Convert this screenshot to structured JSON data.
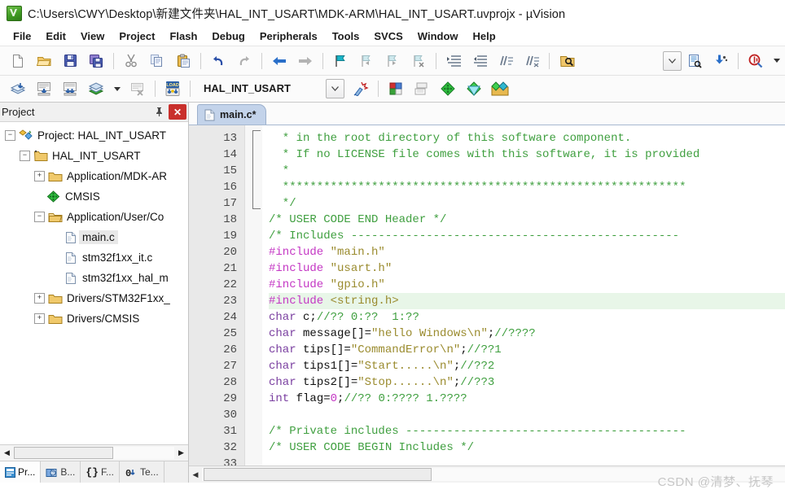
{
  "window": {
    "title": "C:\\Users\\CWY\\Desktop\\新建文件夹\\HAL_INT_USART\\MDK-ARM\\HAL_INT_USART.uvprojx - µVision",
    "app_icon": "uvision-icon"
  },
  "menubar": {
    "items": [
      {
        "label": "File"
      },
      {
        "label": "Edit"
      },
      {
        "label": "View"
      },
      {
        "label": "Project"
      },
      {
        "label": "Flash"
      },
      {
        "label": "Debug"
      },
      {
        "label": "Peripherals"
      },
      {
        "label": "Tools"
      },
      {
        "label": "SVCS"
      },
      {
        "label": "Window"
      },
      {
        "label": "Help"
      }
    ]
  },
  "toolbar_main": {
    "buttons": [
      {
        "name": "new-file-icon",
        "title": "New"
      },
      {
        "name": "open-file-icon",
        "title": "Open"
      },
      {
        "name": "save-icon",
        "title": "Save"
      },
      {
        "name": "save-all-icon",
        "title": "Save All"
      },
      {
        "name": "cut-icon",
        "title": "Cut"
      },
      {
        "name": "copy-icon",
        "title": "Copy"
      },
      {
        "name": "paste-icon",
        "title": "Paste"
      },
      {
        "name": "undo-icon",
        "title": "Undo"
      },
      {
        "name": "redo-icon",
        "title": "Redo"
      },
      {
        "name": "navigate-back-icon",
        "title": "Back"
      },
      {
        "name": "navigate-forward-icon",
        "title": "Forward"
      },
      {
        "name": "bookmark-toggle-icon",
        "title": "Insert/Remove Bookmark"
      },
      {
        "name": "bookmark-prev-icon",
        "title": "Previous Bookmark"
      },
      {
        "name": "bookmark-next-icon",
        "title": "Next Bookmark"
      },
      {
        "name": "bookmark-clear-icon",
        "title": "Clear All Bookmarks"
      },
      {
        "name": "indent-right-icon",
        "title": "Indent"
      },
      {
        "name": "indent-left-icon",
        "title": "Outdent"
      },
      {
        "name": "comment-icon",
        "title": "Comment"
      },
      {
        "name": "uncomment-icon",
        "title": "Uncomment"
      },
      {
        "name": "find-in-files-icon",
        "title": "Find in Files"
      },
      {
        "name": "combo-dropdown-icon",
        "title": "Find combo"
      },
      {
        "name": "browse-file-icon",
        "title": "Configure Files"
      },
      {
        "name": "insert-icon",
        "title": "Insert"
      },
      {
        "name": "debug-find-icon",
        "title": "Find"
      }
    ]
  },
  "toolbar_build": {
    "buttons": [
      {
        "name": "translate-icon",
        "title": "Translate"
      },
      {
        "name": "build-icon",
        "title": "Build"
      },
      {
        "name": "rebuild-icon",
        "title": "Rebuild"
      },
      {
        "name": "batch-build-icon",
        "title": "Batch Build"
      },
      {
        "name": "stop-build-icon",
        "title": "Stop Build"
      },
      {
        "name": "download-icon",
        "title": "Download"
      },
      {
        "name": "target-dropdown-icon",
        "title": "Select Target"
      },
      {
        "name": "target-options-icon",
        "title": "Target Options"
      },
      {
        "name": "manage-project-items-icon",
        "title": "Manage Project Items"
      },
      {
        "name": "multi-project-icon",
        "title": "Multi-Project"
      },
      {
        "name": "pack-installer-icon",
        "title": "Pack Installer"
      },
      {
        "name": "manage-rte-icon",
        "title": "Manage Run-Time Environment"
      },
      {
        "name": "software-packs-icon",
        "title": "Select Software Packs"
      }
    ],
    "target_name": "HAL_INT_USART"
  },
  "project_panel": {
    "title": "Project",
    "pin_glyph": "⚲",
    "close_glyph": "✕",
    "tree": [
      {
        "depth": 0,
        "expander": "minus",
        "icon": "project-icon",
        "label": "Project: HAL_INT_USART",
        "selected": false
      },
      {
        "depth": 1,
        "expander": "minus",
        "icon": "target-icon",
        "label": "HAL_INT_USART",
        "selected": false
      },
      {
        "depth": 2,
        "expander": "plus",
        "icon": "folder-icon",
        "label": "Application/MDK-AR",
        "selected": false
      },
      {
        "depth": 2,
        "expander": "none",
        "icon": "cmsis-icon",
        "label": "CMSIS",
        "selected": false
      },
      {
        "depth": 2,
        "expander": "minus",
        "icon": "folder-open-icon",
        "label": "Application/User/Co",
        "selected": false
      },
      {
        "depth": 3,
        "expander": "none",
        "icon": "c-file-icon",
        "label": "main.c",
        "selected": true
      },
      {
        "depth": 3,
        "expander": "none",
        "icon": "c-file-icon",
        "label": "stm32f1xx_it.c",
        "selected": false
      },
      {
        "depth": 3,
        "expander": "none",
        "icon": "c-file-icon",
        "label": "stm32f1xx_hal_m",
        "selected": false
      },
      {
        "depth": 2,
        "expander": "plus",
        "icon": "folder-icon",
        "label": "Drivers/STM32F1xx_",
        "selected": false
      },
      {
        "depth": 2,
        "expander": "plus",
        "icon": "folder-icon",
        "label": "Drivers/CMSIS",
        "selected": false
      }
    ],
    "tabs": [
      {
        "label": "Pr...",
        "icon": "project-tab-icon",
        "active": true
      },
      {
        "label": "B...",
        "icon": "books-tab-icon",
        "active": false
      },
      {
        "label": "F...",
        "icon": "functions-tab-icon",
        "active": false
      },
      {
        "label": "Te...",
        "icon": "templates-tab-icon",
        "active": false
      }
    ],
    "scroll": {
      "left_arrow": "◀",
      "right_arrow": "▶"
    }
  },
  "editor": {
    "tab": {
      "label": "main.c*",
      "icon": "c-file-icon"
    },
    "first_line_number": 13,
    "scroll": {
      "left_arrow": "◀",
      "right_arrow": "▶"
    },
    "lines": [
      {
        "n": 13,
        "highlight": false,
        "tokens": [
          {
            "c": "cmt",
            "t": "  * in the root directory of this software component."
          }
        ]
      },
      {
        "n": 14,
        "highlight": false,
        "tokens": [
          {
            "c": "cmt",
            "t": "  * If no LICENSE file comes with this software, it is provided"
          }
        ]
      },
      {
        "n": 15,
        "highlight": false,
        "tokens": [
          {
            "c": "cmt",
            "t": "  *"
          }
        ]
      },
      {
        "n": 16,
        "highlight": false,
        "tokens": [
          {
            "c": "cmt",
            "t": "  ***********************************************************"
          }
        ]
      },
      {
        "n": 17,
        "highlight": false,
        "tokens": [
          {
            "c": "cmt",
            "t": "  */"
          }
        ]
      },
      {
        "n": 18,
        "highlight": false,
        "tokens": [
          {
            "c": "cmt",
            "t": "/* USER CODE END Header */"
          }
        ]
      },
      {
        "n": 19,
        "highlight": false,
        "tokens": [
          {
            "c": "cmt",
            "t": "/* Includes ------------------------------------------------"
          }
        ]
      },
      {
        "n": 20,
        "highlight": false,
        "tokens": [
          {
            "c": "pre",
            "t": "#include "
          },
          {
            "c": "str",
            "t": "\"main.h\""
          }
        ]
      },
      {
        "n": 21,
        "highlight": false,
        "tokens": [
          {
            "c": "pre",
            "t": "#include "
          },
          {
            "c": "str",
            "t": "\"usart.h\""
          }
        ]
      },
      {
        "n": 22,
        "highlight": false,
        "tokens": [
          {
            "c": "pre",
            "t": "#include "
          },
          {
            "c": "str",
            "t": "\"gpio.h\""
          }
        ]
      },
      {
        "n": 23,
        "highlight": true,
        "tokens": [
          {
            "c": "pre",
            "t": "#include "
          },
          {
            "c": "str",
            "t": "<string.h>"
          }
        ]
      },
      {
        "n": 24,
        "highlight": false,
        "tokens": [
          {
            "c": "kw",
            "t": "char"
          },
          {
            "c": "plain",
            "t": " c;"
          },
          {
            "c": "cmt",
            "t": "//?? 0:??  1:??"
          }
        ]
      },
      {
        "n": 25,
        "highlight": false,
        "tokens": [
          {
            "c": "kw",
            "t": "char"
          },
          {
            "c": "plain",
            "t": " message[]="
          },
          {
            "c": "str",
            "t": "\"hello Windows\\n\""
          },
          {
            "c": "plain",
            "t": ";"
          },
          {
            "c": "cmt",
            "t": "//????"
          }
        ]
      },
      {
        "n": 26,
        "highlight": false,
        "tokens": [
          {
            "c": "kw",
            "t": "char"
          },
          {
            "c": "plain",
            "t": " tips[]="
          },
          {
            "c": "str",
            "t": "\"CommandError\\n\""
          },
          {
            "c": "plain",
            "t": ";"
          },
          {
            "c": "cmt",
            "t": "//??1"
          }
        ]
      },
      {
        "n": 27,
        "highlight": false,
        "tokens": [
          {
            "c": "kw",
            "t": "char"
          },
          {
            "c": "plain",
            "t": " tips1[]="
          },
          {
            "c": "str",
            "t": "\"Start.....\\n\""
          },
          {
            "c": "plain",
            "t": ";"
          },
          {
            "c": "cmt",
            "t": "//??2"
          }
        ]
      },
      {
        "n": 28,
        "highlight": false,
        "tokens": [
          {
            "c": "kw",
            "t": "char"
          },
          {
            "c": "plain",
            "t": " tips2[]="
          },
          {
            "c": "str",
            "t": "\"Stop......\\n\""
          },
          {
            "c": "plain",
            "t": ";"
          },
          {
            "c": "cmt",
            "t": "//??3"
          }
        ]
      },
      {
        "n": 29,
        "highlight": false,
        "tokens": [
          {
            "c": "kw",
            "t": "int"
          },
          {
            "c": "plain",
            "t": " flag="
          },
          {
            "c": "num",
            "t": "0"
          },
          {
            "c": "plain",
            "t": ";"
          },
          {
            "c": "cmt",
            "t": "//?? 0:???? 1.????"
          }
        ]
      },
      {
        "n": 30,
        "highlight": false,
        "tokens": [
          {
            "c": "plain",
            "t": ""
          }
        ]
      },
      {
        "n": 31,
        "highlight": false,
        "tokens": [
          {
            "c": "cmt",
            "t": "/* Private includes -----------------------------------------"
          }
        ]
      },
      {
        "n": 32,
        "highlight": false,
        "tokens": [
          {
            "c": "cmt",
            "t": "/* USER CODE BEGIN Includes */"
          }
        ]
      },
      {
        "n": 33,
        "highlight": false,
        "tokens": [
          {
            "c": "plain",
            "t": ""
          }
        ]
      }
    ]
  },
  "watermark": {
    "text": "CSDN @清梦、抚琴"
  },
  "colors": {
    "comment": "#3f9f3f",
    "preprocessor": "#c437c4",
    "string": "#9a8b2e",
    "keyword": "#7a3fa0",
    "highlight_line": "#e8f6e8",
    "tab_active": "#c3d3ea",
    "close_button": "#c9302c"
  }
}
